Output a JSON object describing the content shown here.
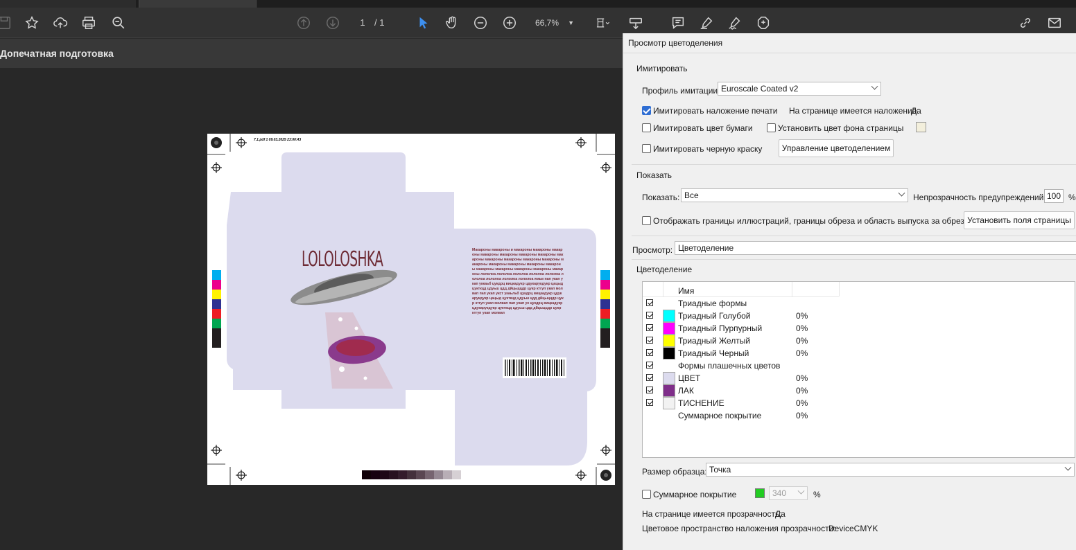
{
  "toolbar": {
    "page_current": "1",
    "page_total": "/ 1",
    "zoom": "66,7%",
    "icons": [
      "save-icon",
      "star-icon",
      "upload-cloud-icon",
      "print-icon",
      "zoom-search-icon",
      "page-up-icon",
      "page-down-icon",
      "pointer-icon",
      "hand-icon",
      "zoom-out-icon",
      "zoom-in-icon",
      "fit-page-icon",
      "scroll-icon",
      "comment-icon",
      "highlight-pen-icon",
      "sign-icon",
      "stamp-icon",
      "link-icon",
      "mail-icon"
    ]
  },
  "panel": {
    "title": "Допечатная подготовка"
  },
  "document": {
    "header_text": "7.1.pdf  1  09.03.2025  23:00:43",
    "brand": "LOLOLOSHKA",
    "body_text": "Макароны макароны и макароны макароны макароны макароны макароны макароны макароны макароны макароны макароны макароны макароны макароны макароны макароны макароны макароны макароны макароны макароны макароны макароны лололоа лололоа лололоа лололоа лололоа лололоа лололоа лололоа лололоа ямьв пап укап укап уккаьб цукдрц вицкадукр цдукарукдукр цацыд цукткцд цдуьш цдд дйцьщцдр цукр ктгуп укап молвап пап укап укст укаьльб цукдрц вицкадукр цдукарукдукр цацыд цукткцд цдуьш цдд дйцьщцдр цукр ктгуп укап молвап пап укап ук цукдрц вицкадукр цдукарукдукр цукткцд цдуьш цдд дйцьщцдр цукр ктгуп укап молвап",
    "colors": {
      "box": "#dcdbee",
      "brand": "#6e2c36",
      "plate": "#8a3a8c"
    }
  },
  "dialog": {
    "title": "Просмотр цветоделения",
    "simulate": {
      "section": "Имитировать",
      "profile_label": "Профиль имитации:",
      "profile_value": "Euroscale Coated v2",
      "overprint_label": "Имитировать наложение печати",
      "overprint_info_label": "На странице имеется наложение:",
      "overprint_info_value": "Да",
      "paper_color_label": "Имитировать цвет бумаги",
      "page_bg_label": "Установить цвет фона страницы",
      "black_ink_label": "Имитировать черную краску",
      "ink_manager_button": "Управление цветоделением"
    },
    "show": {
      "section": "Показать",
      "show_label": "Показать:",
      "show_value": "Все",
      "opacity_label": "Непрозрачность предупреждений:",
      "opacity_value": "100",
      "opacity_unit": "%",
      "boxes_label": "Отображать границы иллюстраций, границы обреза и область выпуска за обрез",
      "page_boxes_button": "Установить поля страницы"
    },
    "preview_label": "Просмотр:",
    "preview_value": "Цветоделение",
    "separations": {
      "section": "Цветоделение",
      "col_name": "Имя",
      "rows": [
        {
          "name": "Триадные формы",
          "pct": "",
          "color": ""
        },
        {
          "name": "Триадный Голубой",
          "pct": "0%",
          "color": "#00ffff"
        },
        {
          "name": "Триадный Пурпурный",
          "pct": "0%",
          "color": "#ff00ff"
        },
        {
          "name": "Триадный Желтый",
          "pct": "0%",
          "color": "#ffff00"
        },
        {
          "name": "Триадный Черный",
          "pct": "0%",
          "color": "#000000"
        },
        {
          "name": "Формы плашечных цветов",
          "pct": "",
          "color": ""
        },
        {
          "name": "ЦВЕТ",
          "pct": "0%",
          "color": "#dcdbee"
        },
        {
          "name": "ЛАК",
          "pct": "0%",
          "color": "#7f2e8a"
        },
        {
          "name": "ТИСНЕНИЕ",
          "pct": "0%",
          "color": "#f2f2f2"
        }
      ],
      "total_label": "Суммарное покрытие",
      "total_value": "0%"
    },
    "sample_label": "Размер образца:",
    "sample_value": "Точка",
    "total_coverage_label": "Суммарное покрытие",
    "total_coverage_value": "340",
    "total_coverage_unit": "%",
    "total_coverage_color": "#22cc22",
    "transparency_label": "На странице имеется прозрачность:",
    "transparency_value": "Да",
    "blend_label": "Цветовое пространство наложения прозрачности:",
    "blend_value": "DeviceCMYK"
  }
}
